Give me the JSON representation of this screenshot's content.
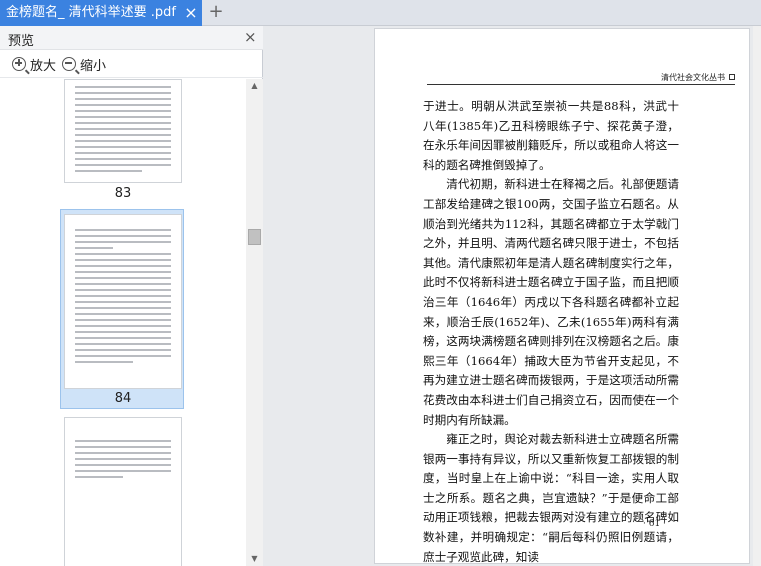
{
  "tabs": [
    {
      "label": "金榜题名_ 清代科举述要 .pdf",
      "active": true
    }
  ],
  "tab_close_glyph": "×",
  "tab_add_glyph": "+",
  "preview": {
    "title": "预览",
    "close_glyph": "×",
    "zoom_in_label": "放大",
    "zoom_out_label": "缩小",
    "thumbnails": [
      {
        "page_number": "83",
        "selected": false
      },
      {
        "page_number": "84",
        "selected": true
      },
      {
        "page_number": "",
        "selected": false
      }
    ]
  },
  "document": {
    "running_head": "清代社会文化丛书",
    "folio": "· 61 ·",
    "paragraphs": [
      {
        "indent": false,
        "text": "于进士。明朝从洪武至崇祯一共是88科，洪武十八年(1385年)乙丑科榜眼练子宁、探花黄子澄，在永乐年间因罪被削籍贬斥，所以或租命人将这一科的题名碑推倒毁掉了。"
      },
      {
        "indent": true,
        "text": "清代初期，新科进士在释褐之后。礼部便题请工部发给建碑之银100两，交国子监立石题名。从顺治到光绪共为112科，其题名碑都立于太学戟门之外，并且明、清两代题名碑只限于进士，不包括其他。清代康熙初年是清人题名碑制度实行之年，此时不仅将新科进士题名碑立于国子监，而且把顺治三年（1646年）丙戌以下各科题名碑都补立起来，顺治壬辰(1652年)、乙未(1655年)两科有满榜，这两块满榜题名碑则排列在汉榜题名之后。康熙三年（1664年）捕政大臣为节省开支起见，不再为建立进士题名碑而拨银两，于是这项活动所需花费改由本科进士们自己捐资立石，因而使在一个时期内有所缺漏。"
      },
      {
        "indent": true,
        "text": "雍正之时，舆论对裁去新科进士立碑题名所需银两一事持有异议，所以又重新恢复工部拨银的制度，当时皇上在上谕中说：“科目一途，实用人取士之所系。题名之典，岂宜遗缺？”于是便命工部动用正项钱粮，把裁去银两对没有建立的题名碑如数补建，并明确规定：“嗣后每科仍照旧例题请，庶士子观览此碑，知读"
      }
    ]
  },
  "colors": {
    "tab_active": "#3b82e0",
    "thumb_selected": "#cfe3f8",
    "panel_bg": "#ffffff",
    "view_bg": "#e8eaed"
  }
}
